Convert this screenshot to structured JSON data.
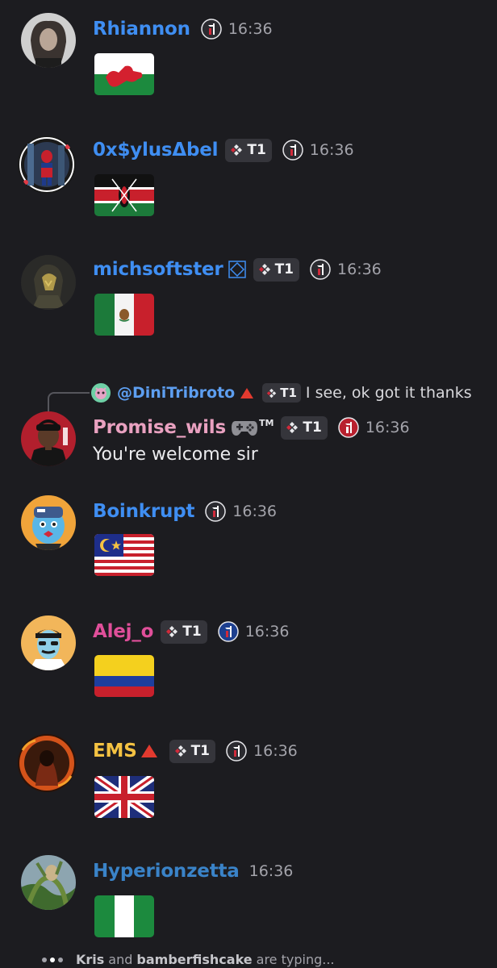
{
  "colors": {
    "background": "#1c1c20",
    "blue_name": "#3f8ef2",
    "pink_name": "#e9a1c0",
    "magenta_name": "#e04f9a",
    "gold_name": "#f4c242",
    "teal_name": "#3a83c8",
    "reply_name": "#5d9ef0",
    "timestamp": "#a3a3aa"
  },
  "messages": [
    {
      "username": "Rhiannon",
      "tag": "",
      "time": "16:36",
      "content_emoji": "flag-wales",
      "badge_icon": "t-badge-dark"
    },
    {
      "username": "0x$ylusΔbel",
      "tag": "T1",
      "time": "16:36",
      "content_emoji": "flag-kenya",
      "badge_icon": "t-badge-dark"
    },
    {
      "username": "michsoftster",
      "tag": "T1",
      "time": "16:36",
      "content_emoji": "flag-mexico",
      "badge_icon": "t-badge-dark"
    },
    {
      "username": "Promise_wils",
      "tag": "T1",
      "time": "16:36",
      "text": "You're welcome sir",
      "tm": "TM",
      "badge_icon": "t-badge-red"
    },
    {
      "username": "Boinkrupt",
      "tag": "",
      "time": "16:36",
      "content_emoji": "flag-malaysia",
      "badge_icon": "t-badge-dark"
    },
    {
      "username": "Alej_o",
      "tag": "T1",
      "time": "16:36",
      "content_emoji": "flag-colombia",
      "badge_icon": "t-badge-blue"
    },
    {
      "username": "EMS",
      "tag": "T1",
      "time": "16:36",
      "content_emoji": "flag-united-kingdom",
      "badge_icon": "t-badge-dark"
    },
    {
      "username": "Hyperionzetta",
      "tag": "",
      "time": "16:36",
      "content_emoji": "flag-nigeria"
    }
  ],
  "reply": {
    "username": "@DiniTribroto",
    "tag": "T1",
    "text": "I see, ok got it thanks"
  },
  "typing": {
    "user1": "Kris",
    "and_text": "and",
    "user2": "bamberfishcake",
    "suffix": "are typing..."
  }
}
